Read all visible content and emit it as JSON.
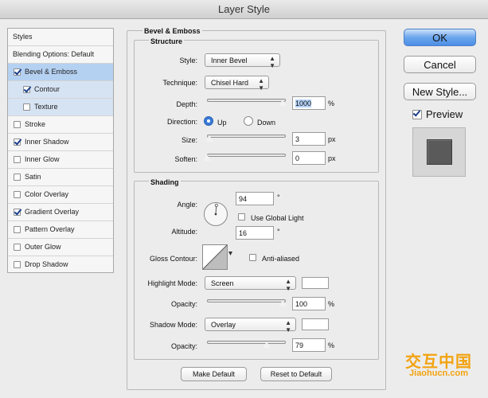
{
  "window": {
    "title": "Layer Style"
  },
  "sidebar": {
    "items": [
      {
        "label": "Styles",
        "checkbox": false,
        "checked": false,
        "state": "header"
      },
      {
        "label": "Blending Options: Default",
        "checkbox": false,
        "checked": false,
        "state": "header"
      },
      {
        "label": "Bevel & Emboss",
        "checkbox": true,
        "checked": true,
        "state": "selected"
      },
      {
        "label": "Contour",
        "checkbox": true,
        "checked": true,
        "state": "sub"
      },
      {
        "label": "Texture",
        "checkbox": true,
        "checked": false,
        "state": "sub"
      },
      {
        "label": "Stroke",
        "checkbox": true,
        "checked": false,
        "state": "normal"
      },
      {
        "label": "Inner Shadow",
        "checkbox": true,
        "checked": true,
        "state": "normal"
      },
      {
        "label": "Inner Glow",
        "checkbox": true,
        "checked": false,
        "state": "normal"
      },
      {
        "label": "Satin",
        "checkbox": true,
        "checked": false,
        "state": "normal"
      },
      {
        "label": "Color Overlay",
        "checkbox": true,
        "checked": false,
        "state": "normal"
      },
      {
        "label": "Gradient Overlay",
        "checkbox": true,
        "checked": true,
        "state": "normal"
      },
      {
        "label": "Pattern Overlay",
        "checkbox": true,
        "checked": false,
        "state": "normal"
      },
      {
        "label": "Outer Glow",
        "checkbox": true,
        "checked": false,
        "state": "normal"
      },
      {
        "label": "Drop Shadow",
        "checkbox": true,
        "checked": false,
        "state": "normal"
      }
    ]
  },
  "bevel": {
    "title": "Bevel & Emboss",
    "structure": {
      "title": "Structure",
      "style_label": "Style:",
      "style_value": "Inner Bevel",
      "technique_label": "Technique:",
      "technique_value": "Chisel Hard",
      "depth_label": "Depth:",
      "depth_value": "1000",
      "depth_unit": "%",
      "depth_fraction": 1.0,
      "direction_label": "Direction:",
      "direction_up": "Up",
      "direction_down": "Down",
      "direction_selected": "Up",
      "size_label": "Size:",
      "size_value": "3",
      "size_unit": "px",
      "size_fraction": 0.02,
      "soften_label": "Soften:",
      "soften_value": "0",
      "soften_unit": "px",
      "soften_fraction": 0.0
    },
    "shading": {
      "title": "Shading",
      "angle_label": "Angle:",
      "angle_value": "94",
      "angle_unit": "°",
      "global_light_label": "Use Global Light",
      "global_light_checked": false,
      "altitude_label": "Altitude:",
      "altitude_value": "16",
      "altitude_unit": "°",
      "gloss_label": "Gloss Contour:",
      "anti_aliased_label": "Anti-aliased",
      "anti_aliased_checked": false,
      "highlight_mode_label": "Highlight Mode:",
      "highlight_mode_value": "Screen",
      "highlight_color": "#ffffff",
      "highlight_opacity_label": "Opacity:",
      "highlight_opacity_value": "100",
      "highlight_opacity_unit": "%",
      "highlight_opacity_fraction": 1.0,
      "shadow_mode_label": "Shadow Mode:",
      "shadow_mode_value": "Overlay",
      "shadow_color": "#ffffff",
      "shadow_opacity_label": "Opacity:",
      "shadow_opacity_value": "79",
      "shadow_opacity_unit": "%",
      "shadow_opacity_fraction": 0.79
    },
    "make_default_label": "Make Default",
    "reset_default_label": "Reset to Default"
  },
  "actions": {
    "ok_label": "OK",
    "cancel_label": "Cancel",
    "new_style_label": "New Style...",
    "preview_label": "Preview",
    "preview_checked": true
  },
  "watermark": {
    "cn": "交互中国",
    "en": "Jiaohucn.com"
  },
  "icons": {
    "popup_arrow": "up-down-arrows-icon",
    "angle_dial": "angle-dial-icon",
    "gloss_contour": "contour-curve-icon"
  }
}
